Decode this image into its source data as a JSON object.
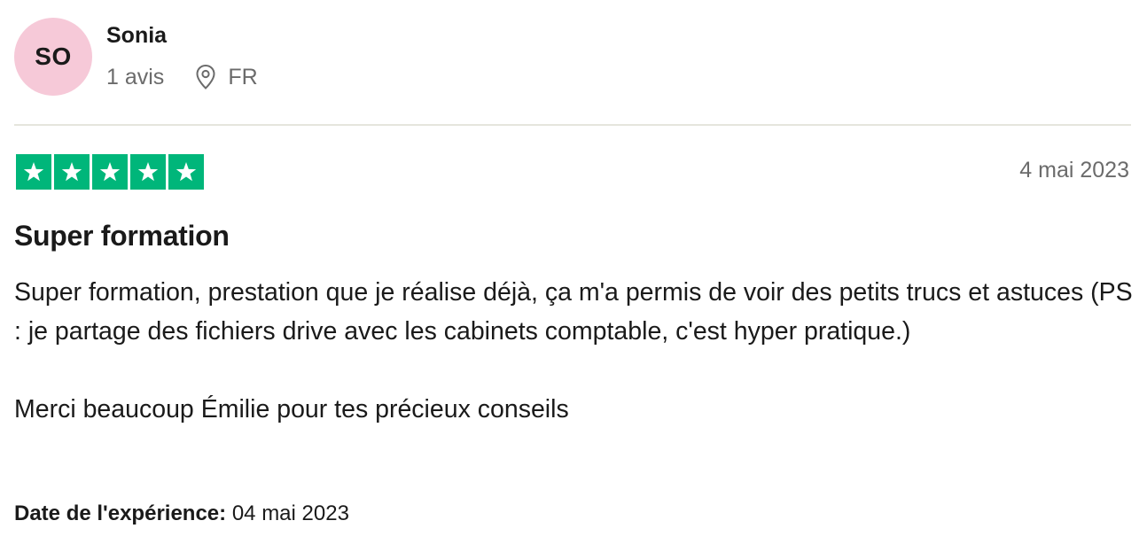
{
  "author": {
    "initials": "SO",
    "name": "Sonia",
    "review_count": "1 avis",
    "location_icon": "map-pin-icon",
    "country": "FR"
  },
  "colors": {
    "avatar_bg": "#f6c9d8",
    "star_green": "#00b67a",
    "muted_text": "#6b6b6b"
  },
  "review": {
    "rating": 5,
    "rating_max": 5,
    "date": "4 mai 2023",
    "title": "Super formation",
    "body_paragraph_1": "Super formation, prestation que je réalise déjà, ça m'a permis de voir des petits trucs et astuces (PS : je partage des fichiers drive avec les cabinets comptable, c'est hyper pratique.)",
    "body_paragraph_2": "Merci beaucoup Émilie pour tes précieux conseils",
    "experience_label": "Date de l'expérience:",
    "experience_date": "04 mai 2023"
  }
}
